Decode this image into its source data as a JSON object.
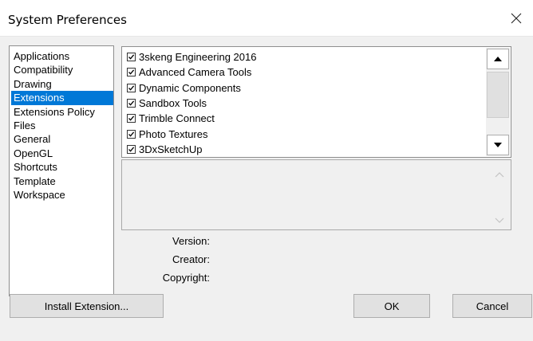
{
  "window": {
    "title": "System Preferences"
  },
  "categories": [
    {
      "label": "Applications",
      "selected": false
    },
    {
      "label": "Compatibility",
      "selected": false
    },
    {
      "label": "Drawing",
      "selected": false
    },
    {
      "label": "Extensions",
      "selected": true
    },
    {
      "label": "Extensions Policy",
      "selected": false
    },
    {
      "label": "Files",
      "selected": false
    },
    {
      "label": "General",
      "selected": false
    },
    {
      "label": "OpenGL",
      "selected": false
    },
    {
      "label": "Shortcuts",
      "selected": false
    },
    {
      "label": "Template",
      "selected": false
    },
    {
      "label": "Workspace",
      "selected": false
    }
  ],
  "extensions": [
    {
      "label": "3skeng Engineering 2016",
      "checked": true
    },
    {
      "label": "Advanced Camera Tools",
      "checked": true
    },
    {
      "label": "Dynamic Components",
      "checked": true
    },
    {
      "label": "Sandbox Tools",
      "checked": true
    },
    {
      "label": "Trimble Connect",
      "checked": true
    },
    {
      "label": "Photo Textures",
      "checked": true
    },
    {
      "label": "3DxSketchUp",
      "checked": true
    }
  ],
  "info": {
    "version_label": "Version:",
    "creator_label": "Creator:",
    "copyright_label": "Copyright:"
  },
  "buttons": {
    "install_label": "Install Extension...",
    "ok_label": "OK",
    "cancel_label": "Cancel"
  },
  "colors": {
    "selection": "#0078d7",
    "window_bg": "#f0f0f0"
  }
}
